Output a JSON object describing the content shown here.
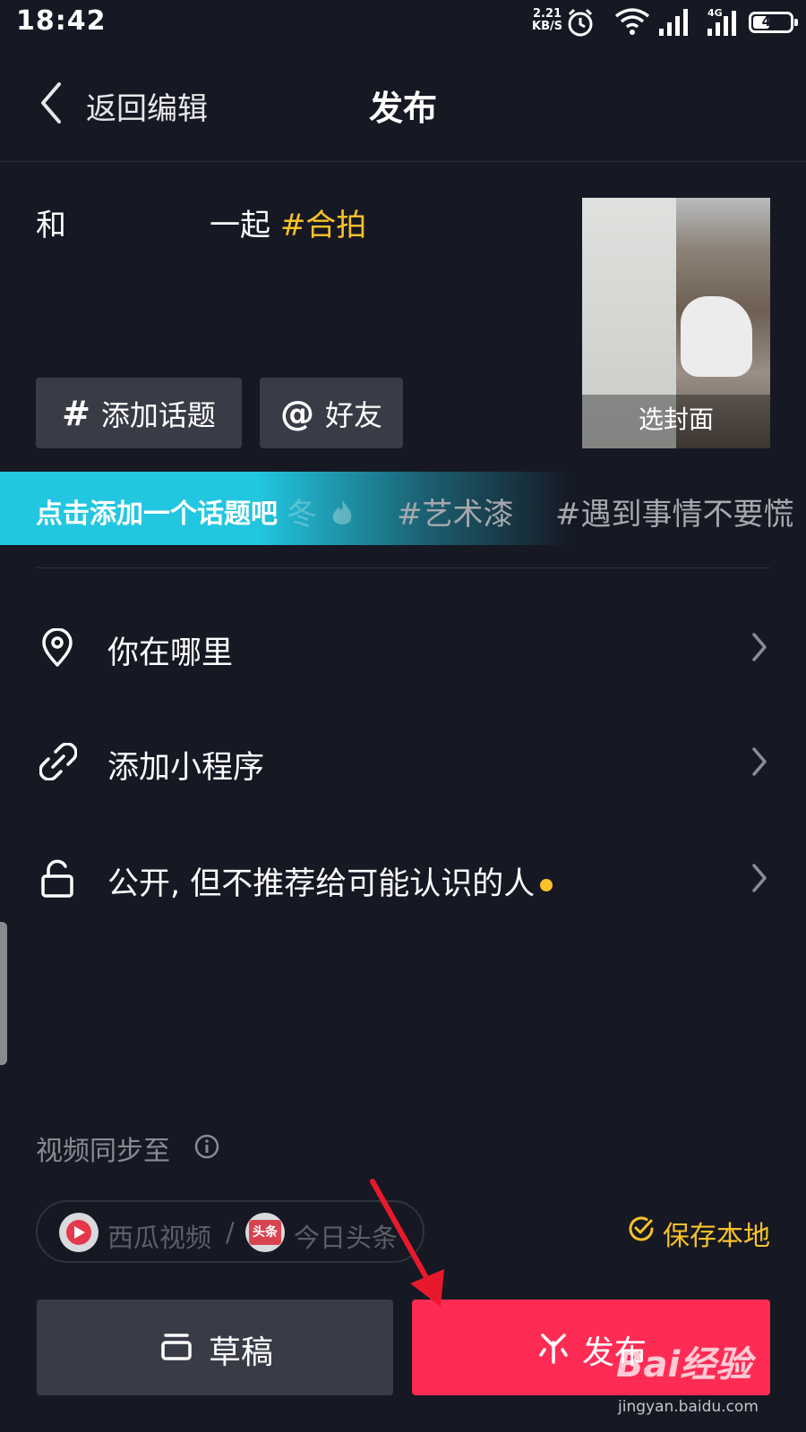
{
  "status_bar": {
    "time": "18:42",
    "net_speed_value": "2.21",
    "net_speed_unit": "KB/S",
    "network_label": "4G",
    "battery_level": "41"
  },
  "header": {
    "back_label": "返回编辑",
    "title": "发布"
  },
  "caption": {
    "prefix": "和",
    "middle": "一起",
    "hashtag": "#合拍"
  },
  "cover": {
    "label": "选封面"
  },
  "chips": {
    "topic_icon": "#",
    "topic_label": "添加话题",
    "friend_icon": "@",
    "friend_label": "好友"
  },
  "topic_bar": {
    "hint": "点击添加一个话题吧",
    "faded_text": "冬",
    "suggestions": [
      "#艺术漆",
      "#遇到事情不要慌"
    ],
    "hot_icon": "fire-icon"
  },
  "rows": [
    {
      "label": "你在哪里",
      "icon": "location-pin-icon"
    },
    {
      "label": "添加小程序",
      "icon": "mini-program-link-icon"
    },
    {
      "label": "公开, 但不推荐给可能认识的人",
      "icon": "unlock-icon"
    }
  ],
  "sync": {
    "label": "视频同步至",
    "xigua": "西瓜视频",
    "separator": "/",
    "toutiao_logo_text": "头条",
    "toutiao": "今日头条",
    "save_local": "保存本地"
  },
  "buttons": {
    "draft": "草稿",
    "publish": "发布"
  },
  "watermark": {
    "logo": "Bai经验",
    "url": "jingyan.baidu.com"
  },
  "colors": {
    "background": "#161823",
    "accent_yellow": "#f9c229",
    "publish_red": "#fe2c55",
    "topic_cyan": "#22c6e0",
    "chip_gray": "#393b46"
  }
}
